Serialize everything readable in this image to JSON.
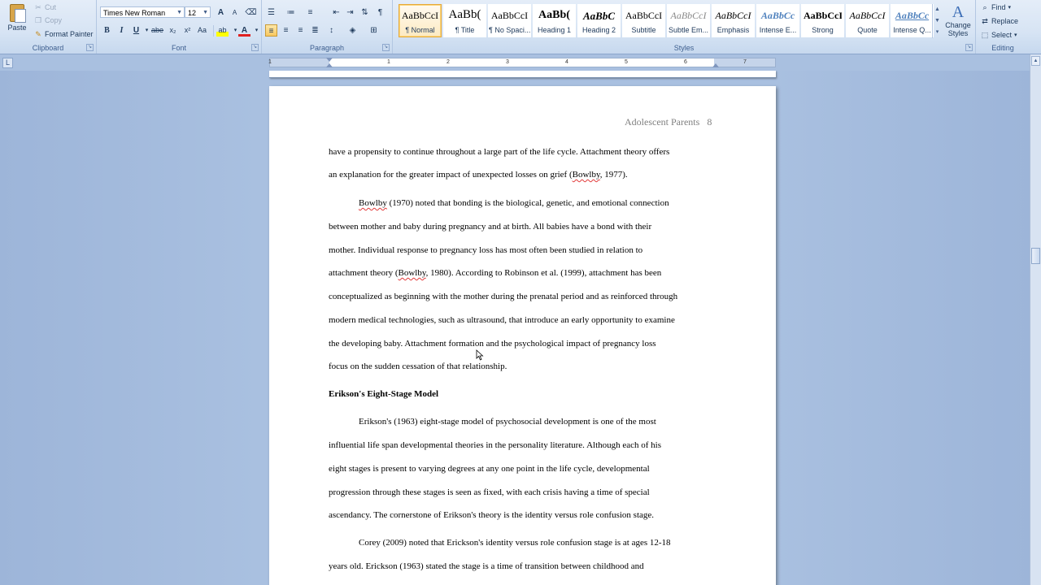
{
  "ribbon": {
    "clipboard": {
      "label": "Clipboard",
      "paste": "Paste",
      "cut": "Cut",
      "copy": "Copy",
      "format_painter": "Format Painter"
    },
    "font": {
      "label": "Font",
      "font_name": "Times New Roman",
      "font_size": "12",
      "bold": "B",
      "italic": "I",
      "underline": "U",
      "strike": "abe",
      "subscript": "x₂",
      "superscript": "x²",
      "change_case": "Aa",
      "grow": "A",
      "shrink": "A",
      "highlight": "ab",
      "font_color": "A"
    },
    "paragraph": {
      "label": "Paragraph",
      "show_marks": "¶"
    },
    "styles": {
      "label": "Styles",
      "items": [
        {
          "preview": "AaBbCcI",
          "name": "¶ Normal"
        },
        {
          "preview": "AaBb(",
          "name": "¶ Title"
        },
        {
          "preview": "AaBbCcI",
          "name": "¶ No Spaci..."
        },
        {
          "preview": "AaBb(",
          "name": "Heading 1"
        },
        {
          "preview": "AaBbC",
          "name": "Heading 2"
        },
        {
          "preview": "AaBbCcI",
          "name": "Subtitle"
        },
        {
          "preview": "AaBbCcI",
          "name": "Subtle Em..."
        },
        {
          "preview": "AaBbCcI",
          "name": "Emphasis"
        },
        {
          "preview": "AaBbCc",
          "name": "Intense E..."
        },
        {
          "preview": "AaBbCcI",
          "name": "Strong"
        },
        {
          "preview": "AaBbCcI",
          "name": "Quote"
        },
        {
          "preview": "AaBbCc",
          "name": "Intense Q..."
        }
      ],
      "change_styles": "Change Styles",
      "change_styles_icon": "A"
    },
    "editing": {
      "label": "Editing",
      "find": "Find",
      "replace": "Replace",
      "select": "Select"
    }
  },
  "ruler": {
    "numbers": [
      "1",
      "1",
      "2",
      "3",
      "4",
      "5",
      "6",
      "7"
    ]
  },
  "document": {
    "header": "Adolescent Parents",
    "page_number": "8",
    "lines": [
      "have a propensity to continue throughout a large part of the life cycle. Attachment theory offers",
      "an explanation for the greater impact of unexpected losses on grief (",
      "Bowlby",
      ", 1977).",
      "Bowlby",
      " (1970) noted that bonding is the biological, genetic, and emotional connection",
      "between mother and baby during pregnancy and at birth.  All babies have a bond with their",
      "mother.  Individual response to pregnancy loss has most often been studied in relation to",
      "attachment theory (",
      "Bowlby",
      ", 1980).  According to Robinson et al. (1999), attachment has been",
      "conceptualized as beginning with the mother during the prenatal period and as reinforced through",
      "modern medical technologies, such as ultrasound, that introduce an early opportunity to examine",
      "the developing baby.  Attachment formation and the psychological impact of pregnancy loss",
      "focus on the sudden cessation of that relationship.",
      "Erikson's Eight-Stage Model",
      "Erikson's (1963) eight-stage model of psychosocial development is one of the most",
      "influential life span developmental theories in the personality literature.  Although each of his",
      "eight stages is present to varying degrees at any one point in the life cycle, developmental",
      "progression through these stages is seen as fixed, with each crisis having a time of special",
      "ascendancy.  The cornerstone of Erikson's theory is the identity versus role confusion stage.",
      "Corey (2009) noted that Erickson's identity versus role confusion stage is at ages 12-18",
      "years old.  Erickson (1963) stated the stage is a time of transition between childhood and"
    ]
  }
}
